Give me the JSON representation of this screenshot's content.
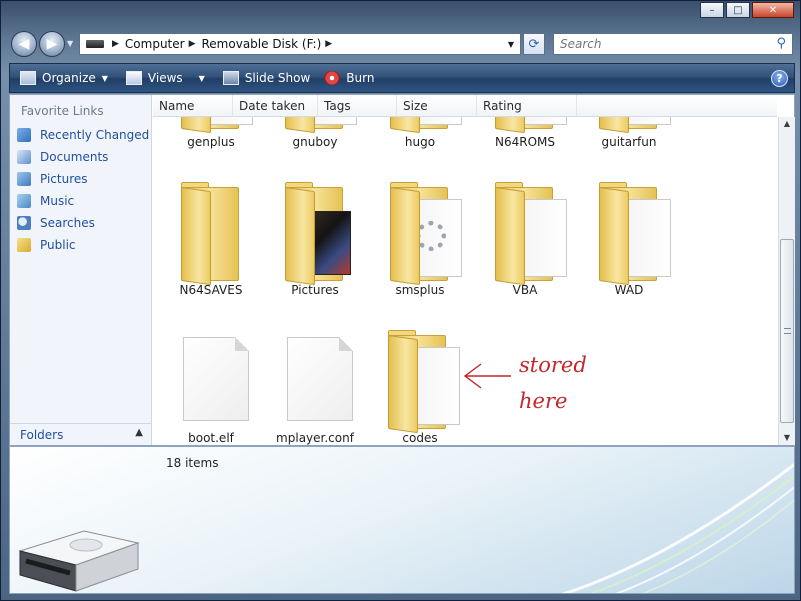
{
  "window": {
    "controls": {
      "minimize": "–",
      "maximize": "□",
      "close": "✕"
    }
  },
  "nav": {
    "back_icon": "back-arrow-icon",
    "forward_icon": "forward-arrow-icon",
    "breadcrumb": [
      "Computer",
      "Removable Disk (F:)"
    ],
    "search_placeholder": "Search"
  },
  "toolbar": {
    "organize": "Organize",
    "views": "Views",
    "slideshow": "Slide Show",
    "burn": "Burn",
    "help": "?"
  },
  "sidebar": {
    "title": "Favorite Links",
    "items": [
      {
        "label": "Recently Changed",
        "icon": "recently-changed-icon"
      },
      {
        "label": "Documents",
        "icon": "documents-icon"
      },
      {
        "label": "Pictures",
        "icon": "pictures-icon"
      },
      {
        "label": "Music",
        "icon": "music-icon"
      },
      {
        "label": "Searches",
        "icon": "searches-icon"
      },
      {
        "label": "Public",
        "icon": "public-icon"
      }
    ],
    "folders_label": "Folders"
  },
  "columns": [
    "Name",
    "Date taken",
    "Tags",
    "Size",
    "Rating"
  ],
  "files": [
    {
      "name": "genplus",
      "type": "folder"
    },
    {
      "name": "gnuboy",
      "type": "folder"
    },
    {
      "name": "hugo",
      "type": "folder"
    },
    {
      "name": "N64ROMS",
      "type": "folder"
    },
    {
      "name": "guitarfun",
      "type": "folder"
    },
    {
      "name": "N64SAVES",
      "type": "folder"
    },
    {
      "name": "Pictures",
      "type": "folder"
    },
    {
      "name": "smsplus",
      "type": "folder"
    },
    {
      "name": "VBA",
      "type": "folder"
    },
    {
      "name": "WAD",
      "type": "folder"
    },
    {
      "name": "boot.elf",
      "type": "file"
    },
    {
      "name": "mplayer.conf",
      "type": "file"
    },
    {
      "name": "codes",
      "type": "folder"
    }
  ],
  "annotation": {
    "line1": "stored",
    "line2": "here",
    "color": "#c4272b"
  },
  "status": {
    "item_count": "18 items"
  }
}
